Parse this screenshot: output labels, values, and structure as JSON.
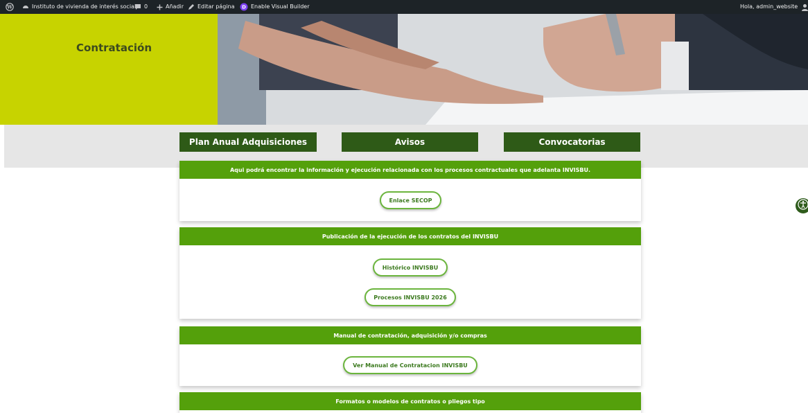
{
  "adminbar": {
    "site_name": "Instituto de vivienda de interés social...",
    "comments_count": "0",
    "add_new": "Añadir",
    "edit_page": "Editar página",
    "visual_builder": "Enable Visual Builder",
    "greeting": "Hola, admin_website"
  },
  "hero": {
    "title": "Contratación"
  },
  "nav": {
    "plan": "Plan Anual Adquisiciones",
    "avisos": "Avisos",
    "convocatorias": "Convocatorias"
  },
  "sections": [
    {
      "header": "Aqui podrá encontrar la información y ejecución relacionada con los procesos contractuales que adelanta INVISBU.",
      "buttons": [
        "Enlace SECOP"
      ]
    },
    {
      "header": "Publicación de la ejecución de los contratos del INVISBU",
      "buttons": [
        "Histórico INVISBU",
        "Procesos INVISBU 2026"
      ]
    },
    {
      "header": "Manual de contratación, adquisición y/o compras",
      "buttons": [
        "Ver Manual de Contratacion INVISBU"
      ]
    },
    {
      "header": "Formatos o modelos de contratos o pliegos tipo",
      "buttons": []
    }
  ],
  "colors": {
    "accent_green": "#54a00b",
    "dark_green": "#2e5a17",
    "lime": "#c7d300",
    "admin_bar": "#1d2327"
  },
  "icons": [
    "wordpress-icon",
    "dashboard-icon",
    "comment-icon",
    "plus-icon",
    "pencil-icon",
    "divi-icon",
    "user-avatar-icon",
    "accessibility-icon"
  ]
}
